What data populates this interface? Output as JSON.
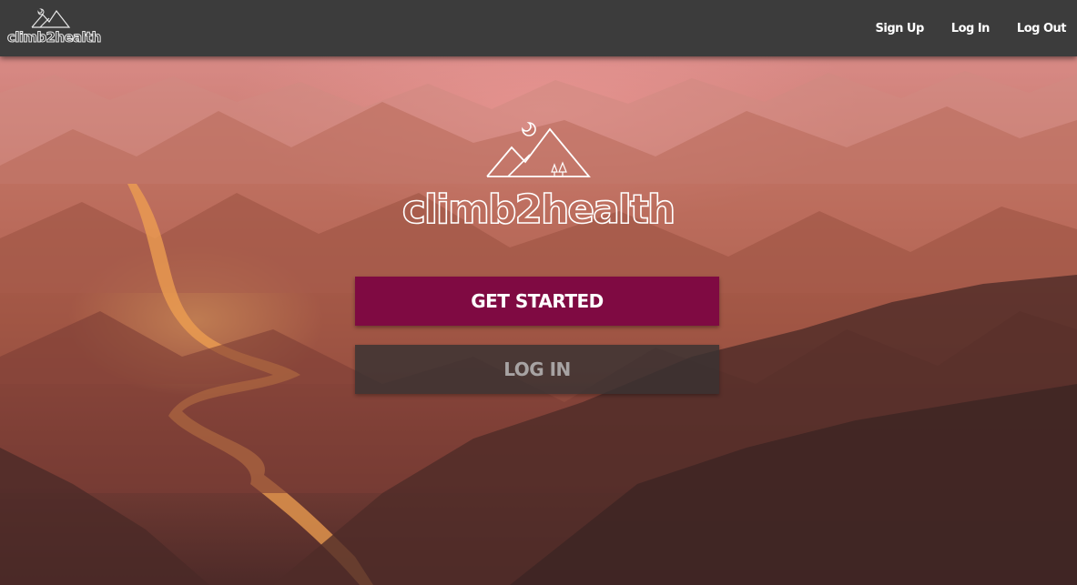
{
  "navbar": {
    "logo_text": "climb2health",
    "links": [
      "Sign Up",
      "Log In",
      "Log Out"
    ]
  },
  "hero": {
    "brand": "climb2health",
    "primary_button": "GET STARTED",
    "secondary_button": "LOG IN"
  },
  "colors": {
    "navbar_bg": "#3c3c3c",
    "primary_button_bg": "#7f0a42",
    "secondary_button_bg": "#383232",
    "secondary_button_text": "#a7a3a3"
  },
  "icons": {
    "logo": "mountains-moon-trees-icon"
  }
}
